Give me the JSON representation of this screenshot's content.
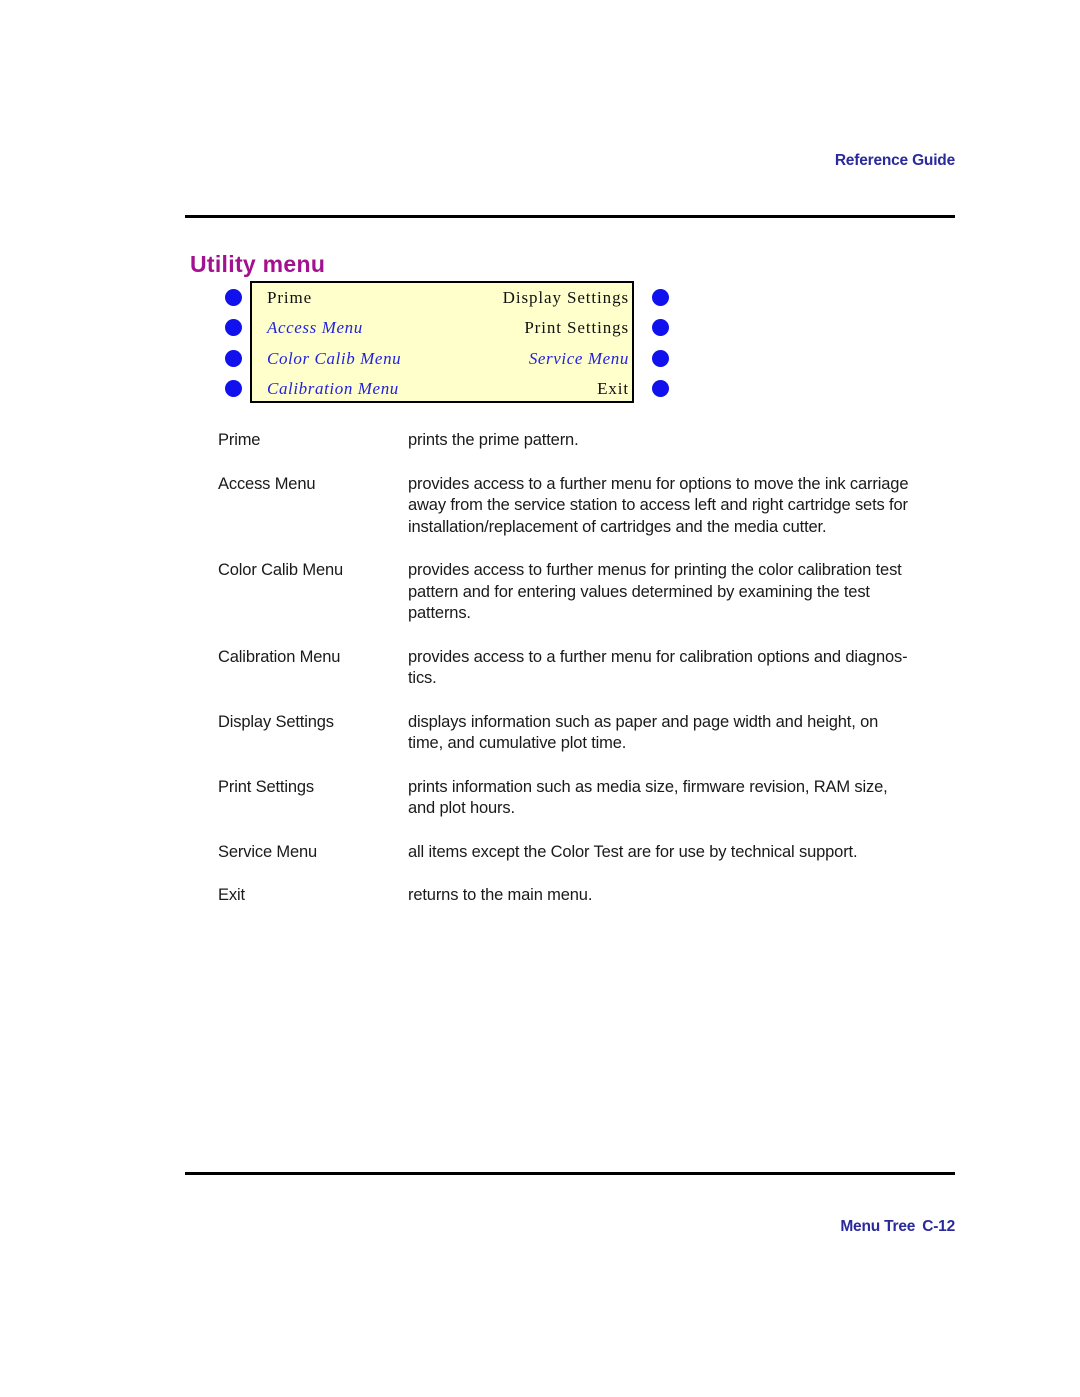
{
  "header": {
    "running_head": "Reference Guide"
  },
  "section": {
    "title": "Utility  menu"
  },
  "menu_diagram": {
    "background_color": "#FFFFCC",
    "border_color": "#000000",
    "bullet_color": "#1111EE",
    "submenu_text_color": "#2222DD",
    "plain_text_color": "#111111",
    "rows": [
      {
        "left": "Prime",
        "left_style": "plain",
        "right": "Display Settings",
        "right_style": "plain"
      },
      {
        "left": "Access Menu",
        "left_style": "submenu",
        "right": "Print Settings",
        "right_style": "plain"
      },
      {
        "left": "Color Calib Menu",
        "left_style": "submenu",
        "right": "Service Menu",
        "right_style": "submenu"
      },
      {
        "left": "Calibration Menu",
        "left_style": "submenu",
        "right": "Exit",
        "right_style": "plain"
      }
    ]
  },
  "definitions": [
    {
      "term": "Prime",
      "lines": [
        "prints the prime pattern."
      ]
    },
    {
      "term": "Access Menu",
      "lines": [
        "provides access to a further menu for options to move the ink carriage",
        "away from the service station to access left and right cartridge sets for",
        "installation/replacement of cartridges and the media cutter."
      ]
    },
    {
      "term": "Color Calib Menu",
      "lines": [
        "provides access to further menus for printing the color calibration test",
        "pattern and for entering values determined by examining the test",
        "patterns."
      ]
    },
    {
      "term": "Calibration Menu",
      "lines": [
        "provides access to a further menu for calibration options and diagnos-",
        "tics."
      ]
    },
    {
      "term": "Display Settings",
      "lines": [
        "displays information such as paper and page width and height, on",
        "time, and cumulative plot time."
      ]
    },
    {
      "term": "Print Settings",
      "lines": [
        "prints information such as media size, firmware revision, RAM size,",
        "and plot hours."
      ]
    },
    {
      "term": "Service Menu",
      "lines": [
        "all items except the Color Test are for use by technical support."
      ]
    },
    {
      "term": "Exit",
      "lines": [
        "returns to the main menu."
      ]
    }
  ],
  "footer": {
    "chapter": "Menu Tree",
    "page_number": "C-12"
  }
}
